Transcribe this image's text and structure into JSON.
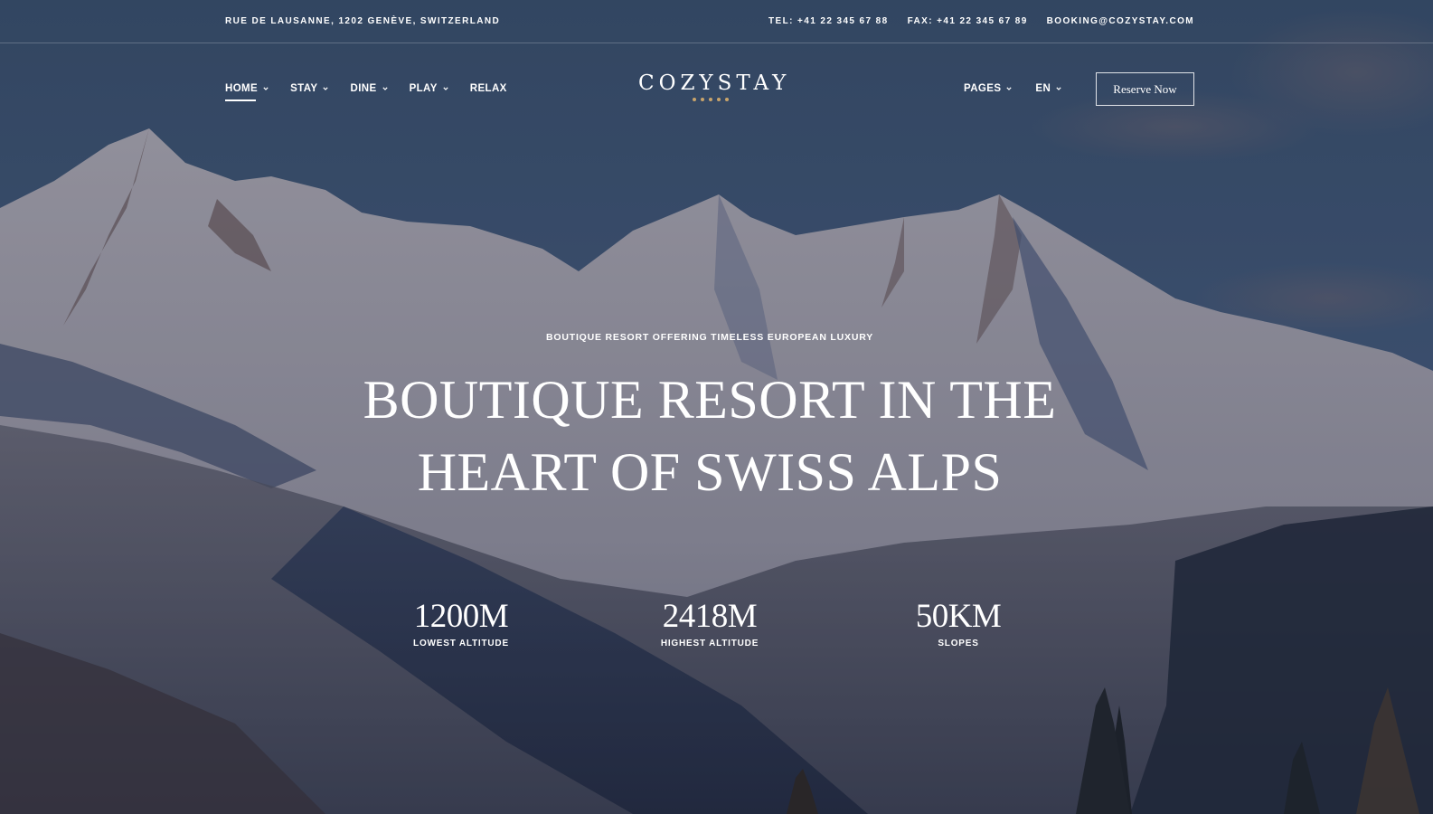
{
  "topbar": {
    "address": "RUE DE LAUSANNE, 1202 GENÈVE, SWITZERLAND",
    "tel": "TEL: +41 22 345 67 88",
    "fax": "FAX: +41 22 345 67 89",
    "email": "BOOKING@COZYSTAY.COM"
  },
  "nav": {
    "left": [
      {
        "label": "HOME",
        "dropdown": true,
        "active": true
      },
      {
        "label": "STAY",
        "dropdown": true
      },
      {
        "label": "DINE",
        "dropdown": true
      },
      {
        "label": "PLAY",
        "dropdown": true
      },
      {
        "label": "RELAX",
        "dropdown": false
      }
    ],
    "right": [
      {
        "label": "PAGES",
        "dropdown": true
      },
      {
        "label": "EN",
        "dropdown": true
      }
    ],
    "reserve_label": "Reserve Now"
  },
  "logo": {
    "name": "COZYSTAY",
    "stars": 5,
    "star_color": "#c9a46b"
  },
  "hero": {
    "kicker": "BOUTIQUE RESORT OFFERING TIMELESS EUROPEAN LUXURY",
    "headline_line1": "BOUTIQUE RESORT IN THE",
    "headline_line2": "HEART OF SWISS ALPS",
    "background": "snow-capped-mountains-image"
  },
  "stats": [
    {
      "value": "1200M",
      "label": "LOWEST ALTITUDE"
    },
    {
      "value": "2418M",
      "label": "HIGHEST ALTITUDE"
    },
    {
      "value": "50KM",
      "label": "SLOPES"
    }
  ],
  "colors": {
    "sky": "#3d5470",
    "overlay": "#1e2c44",
    "accent_gold": "#c9a46b",
    "text": "#ffffff"
  }
}
